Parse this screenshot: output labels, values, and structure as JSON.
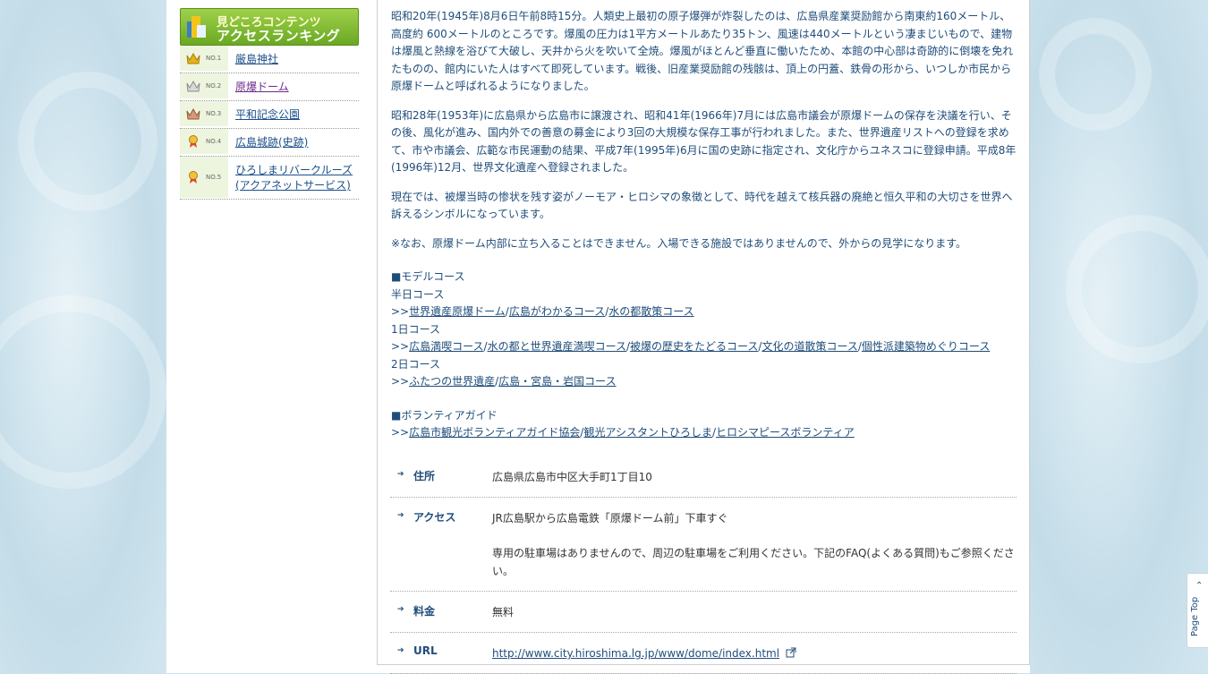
{
  "sidebar": {
    "header_line1": "見どころコンテンツ",
    "header_line2": "アクセスランキング",
    "items": [
      {
        "no": "NO.1",
        "label": "厳島神社",
        "crown": "gold-crown-icon"
      },
      {
        "no": "NO.2",
        "label": "原爆ドーム",
        "crown": "silver-crown-icon"
      },
      {
        "no": "NO.3",
        "label": "平和記念公園",
        "crown": "bronze-crown-icon"
      },
      {
        "no": "NO.4",
        "label": "広島城跡(史跡)",
        "crown": "medal-icon"
      },
      {
        "no": "NO.5",
        "label": "ひろしまリバークルーズ(アクアネットサービス)",
        "crown": "medal-icon"
      }
    ]
  },
  "content": {
    "para1": "昭和20年(1945年)8月6日午前8時15分。人類史上最初の原子爆弾が炸裂したのは、広島県産業奨励館から南東約160メートル、高度約 600メートルのところです。爆風の圧力は1平方メートルあたり35トン、風速は440メートルという凄まじいもので、建物は爆風と熱線を浴びて大破し、天井から火を吹いて全焼。爆風がほとんど垂直に働いたため、本館の中心部は奇跡的に倒壊を免れたものの、館内にいた人はすべて即死しています。戦後、旧産業奨励館の残骸は、頂上の円蓋、鉄骨の形から、いつしか市民から原爆ドームと呼ばれるようになりました。",
    "para2": "昭和28年(1953年)に広島県から広島市に譲渡され、昭和41年(1966年)7月には広島市議会が原爆ドームの保存を決議を行い、その後、風化が進み、国内外での善意の募金により3回の大規模な保存工事が行われました。また、世界遺産リストへの登録を求めて、市や市議会、広範な市民運動の結果、平成7年(1995年)6月に国の史跡に指定され、文化庁からユネスコに登録申請。平成8年(1996年)12月、世界文化遺産へ登録されました。",
    "para3": "現在では、被爆当時の惨状を残す姿がノーモア・ヒロシマの象徴として、時代を越えて核兵器の廃絶と恒久平和の大切さを世界へ訴えるシンボルになっています。",
    "para4": "※なお、原爆ドーム内部に立ち入ることはできません。入場できる施設ではありませんので、外からの見学になります。",
    "model": {
      "title": "■モデルコース",
      "half_day": "半日コース",
      "half_links": [
        "世界遺産原爆ドーム",
        "広島がわかるコース",
        "水の都散策コース"
      ],
      "one_day": "1日コース",
      "one_links": [
        "広島満喫コース",
        "水の都と世界遺産満喫コース",
        "被爆の歴史をたどるコース",
        "文化の道散策コース",
        "個性派建築物めぐりコース"
      ],
      "two_day": "2日コース",
      "two_links": [
        "ふたつの世界遺産",
        "広島・宮島・岩国コース"
      ]
    },
    "volunteer": {
      "title": "■ボランティアガイド",
      "links": [
        "広島市観光ボランティアガイド協会",
        "観光アシスタントひろしま",
        "ヒロシマピースボランティア"
      ]
    },
    "prefix": ">>",
    "sep": "/"
  },
  "info": {
    "address_label": "住所",
    "address_value": "広島県広島市中区大手町1丁目10",
    "access_label": "アクセス",
    "access_value1": "JR広島駅から広島電鉄「原爆ドーム前」下車すぐ",
    "access_value2": "専用の駐車場はありませんので、周辺の駐車場をご利用ください。下記のFAQ(よくある質問)もご参照ください。",
    "fee_label": "料金",
    "fee_value": "無料",
    "url_label": "URL",
    "url_value": "http://www.city.hiroshima.lg.jp/www/dome/index.html"
  },
  "pagetop": {
    "label": "Page Top"
  }
}
